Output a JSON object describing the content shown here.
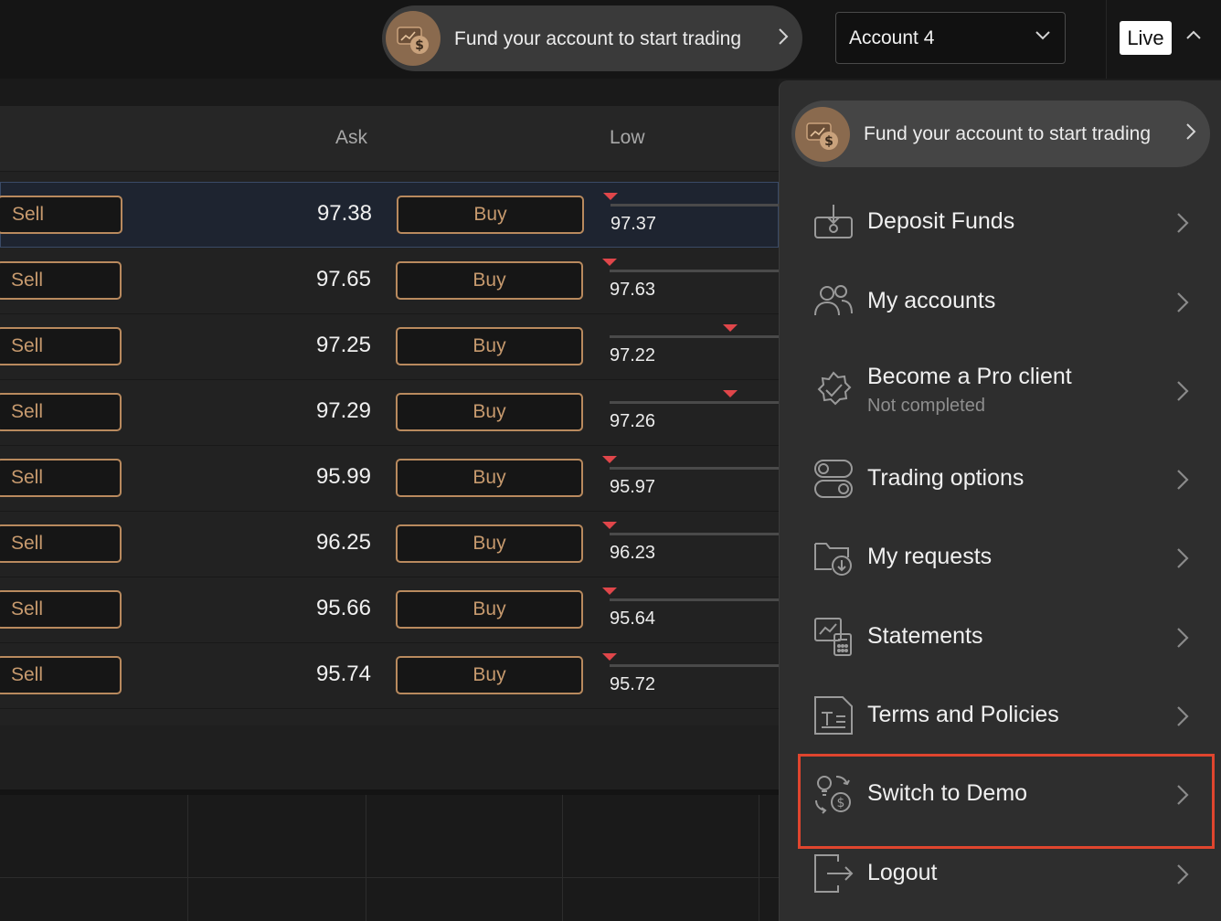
{
  "topbar": {
    "fund_banner": "Fund your account to start trading",
    "account_select": "Account 4",
    "mode_badge": "Live"
  },
  "table": {
    "headers": {
      "ask": "Ask",
      "low": "Low"
    },
    "sell_label": "Sell",
    "buy_label": "Buy",
    "rows": [
      {
        "ask": "97.38",
        "low": "97.37"
      },
      {
        "ask": "97.65",
        "low": "97.63"
      },
      {
        "ask": "97.25",
        "low": "97.22"
      },
      {
        "ask": "97.29",
        "low": "97.26"
      },
      {
        "ask": "95.99",
        "low": "95.97"
      },
      {
        "ask": "96.25",
        "low": "96.23"
      },
      {
        "ask": "95.66",
        "low": "95.64"
      },
      {
        "ask": "95.74",
        "low": "95.72"
      }
    ]
  },
  "menu": {
    "fund_banner": "Fund your account to start trading",
    "items": [
      {
        "label": "Deposit Funds",
        "icon": "deposit-icon"
      },
      {
        "label": "My accounts",
        "icon": "users-icon"
      },
      {
        "label": "Become a Pro client",
        "sub": "Not completed",
        "icon": "badge-check-icon"
      },
      {
        "label": "Trading options",
        "icon": "toggles-icon"
      },
      {
        "label": "My requests",
        "icon": "folder-download-icon"
      },
      {
        "label": "Statements",
        "icon": "statement-icon"
      },
      {
        "label": "Terms and Policies",
        "icon": "document-icon"
      },
      {
        "label": "Switch to Demo",
        "icon": "switch-demo-icon"
      },
      {
        "label": "Logout",
        "icon": "logout-icon"
      }
    ]
  },
  "colors": {
    "accent": "#b98a5e",
    "highlight": "#e0452e",
    "down": "#e0464a"
  }
}
